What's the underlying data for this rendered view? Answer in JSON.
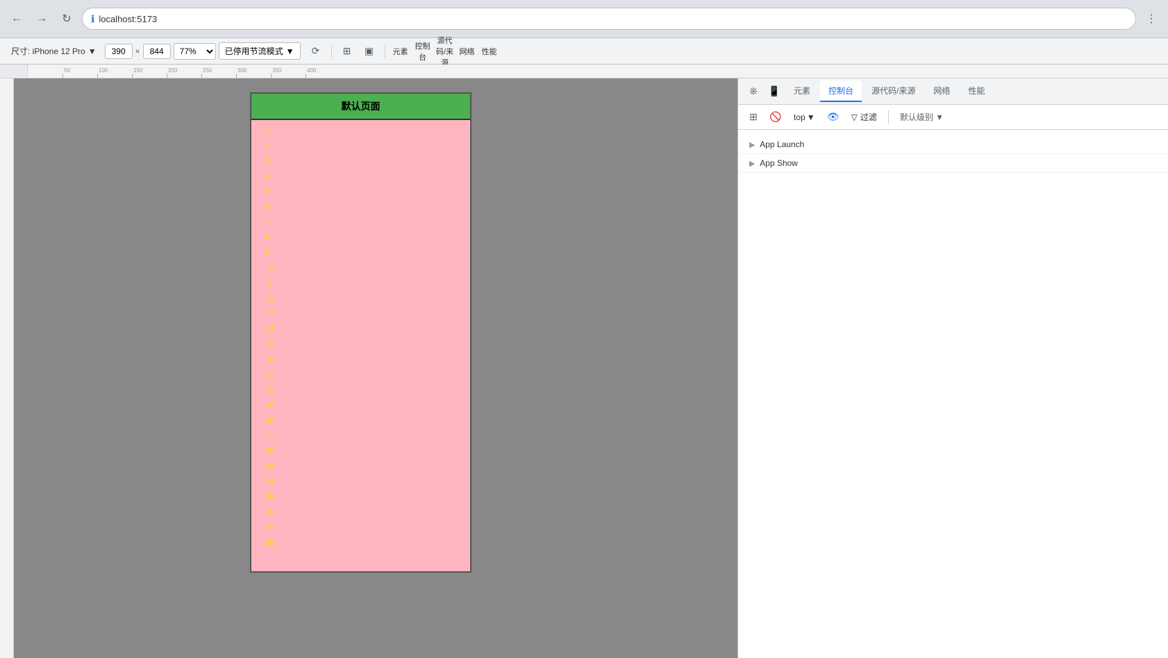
{
  "browser": {
    "url": "localhost:5173",
    "back_label": "←",
    "forward_label": "→",
    "refresh_label": "↻",
    "info_icon": "ℹ",
    "more_icon": "⋮"
  },
  "devtools_toolbar": {
    "device": "尺寸: iPhone 12 Pro",
    "width": "390",
    "height": "844",
    "zoom": "77%",
    "throttle": "已停用节流模式",
    "throttle_arrow": "▼"
  },
  "viewport": {
    "page_title": "默认页面",
    "line_numbers": [
      "1",
      "2",
      "3",
      "4",
      "5",
      "6",
      "7",
      "8",
      "9",
      "10",
      "11",
      "12",
      "13",
      "14",
      "15",
      "16",
      "17",
      "18",
      "19",
      "20",
      "21",
      "22",
      "23",
      "24",
      "25",
      "26",
      "27",
      "28"
    ]
  },
  "devtools_panel": {
    "tabs": [
      {
        "label": "元素",
        "active": false
      },
      {
        "label": "控制台",
        "active": false
      },
      {
        "label": "源代码/来源",
        "active": false
      },
      {
        "label": "网络",
        "active": false
      },
      {
        "label": "性能",
        "active": false
      }
    ],
    "subtabs": {
      "top_label": "top",
      "filter_label": "过滤",
      "category_label": "默认级别 ▼"
    },
    "console_items": [
      {
        "label": "App Launch"
      },
      {
        "label": "App Show"
      }
    ]
  }
}
